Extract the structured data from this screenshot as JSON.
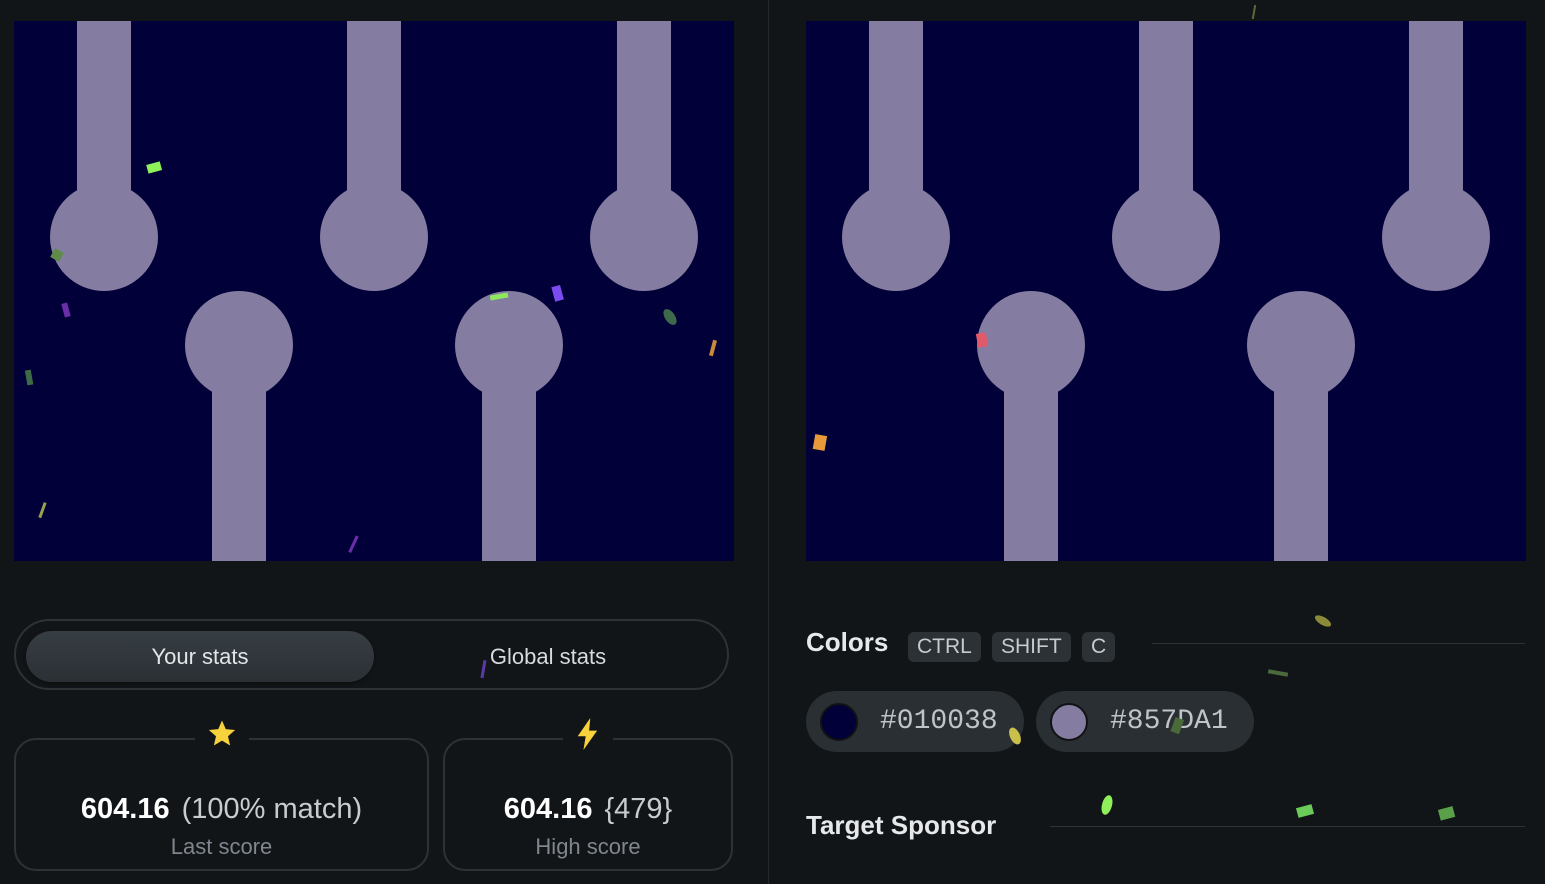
{
  "game": {
    "your_canvas": {
      "background_color": "#010038",
      "shape_color": "#857DA1"
    },
    "target_canvas": {
      "background_color": "#010038",
      "shape_color": "#857DA1"
    }
  },
  "tabs": {
    "your_stats": "Your stats",
    "global_stats": "Global stats"
  },
  "stats": {
    "last": {
      "icon": "star-icon",
      "score": "604.16",
      "match": "(100% match)",
      "label": "Last score"
    },
    "high": {
      "icon": "lightning-icon",
      "score": "604.16",
      "rank": "{479}",
      "label": "High score"
    }
  },
  "colors": {
    "title": "Colors",
    "shortcut": [
      "CTRL",
      "SHIFT",
      "C"
    ],
    "swatches": [
      {
        "hex": "#010038"
      },
      {
        "hex": "#857DA1"
      }
    ]
  },
  "sponsor": {
    "title": "Target Sponsor"
  }
}
